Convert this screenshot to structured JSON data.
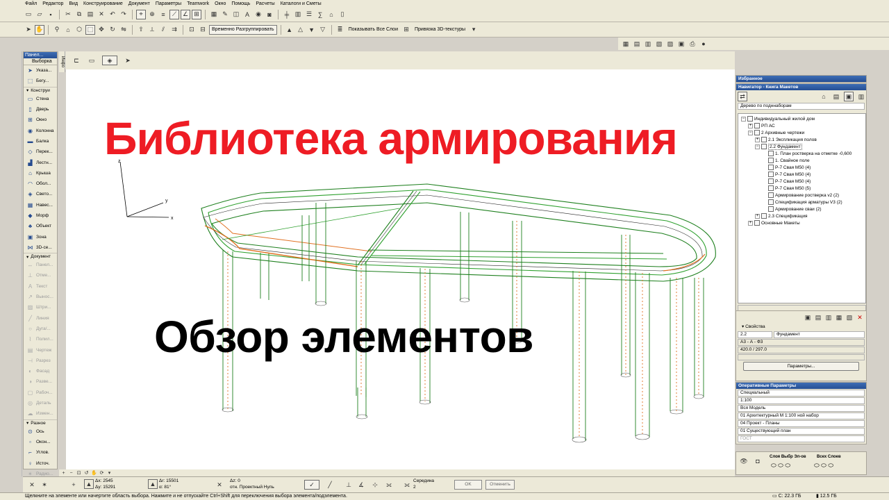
{
  "menu": [
    "Файл",
    "Редактор",
    "Вид",
    "Конструирование",
    "Документ",
    "Параметры",
    "Teamwork",
    "Окно",
    "Помощь",
    "Расчеты",
    "Каталоги и Сметы"
  ],
  "toolbar": {
    "ungroup_label": "Временно Разгруппировать",
    "show_all_layers": "Показывать Все Слои",
    "texture_binding": "Привязка 3D-текстуры"
  },
  "toolbox": {
    "header": "Панел...",
    "tab": "Выборка",
    "arrow_tool": "Указа...",
    "marquee_tool": "Бегу...",
    "group_construction": "Конструи",
    "construction_tools": [
      "Стена",
      "Дверь",
      "Окно",
      "Колонна",
      "Балка",
      "Перек...",
      "Лестн...",
      "Крыша",
      "Обол...",
      "Свето...",
      "Навес...",
      "Морф",
      "Объект",
      "Зона",
      "3D-се..."
    ],
    "group_document": "Документ",
    "document_tools": [
      "Панел...",
      "Отме...",
      "Текст",
      "Вынос...",
      "Штри...",
      "Линия",
      "Дуга/...",
      "Полил...",
      "Чертеж",
      "Разрез",
      "Фасад",
      "Разве...",
      "Рабоч...",
      "Деталь",
      "Измен..."
    ],
    "group_more": "Разное",
    "more_tools": [
      "Ось",
      "Окон...",
      "Углов.",
      "Источ.",
      "Радио..."
    ]
  },
  "infobar_tab": "Инфо",
  "overlay": {
    "title_red": "Библиотека армирования",
    "title_black": "Обзор элементов"
  },
  "axes": {
    "z": "z",
    "y": "y",
    "x": "x"
  },
  "favorites": {
    "title": "Избранное"
  },
  "navigator": {
    "title": "Навигатор - Книга Макетов",
    "view_mode": "Дерево по подннаборам",
    "tree": [
      {
        "label": "Индивидуальный жилой дом",
        "level": 0
      },
      {
        "label": "РП АС",
        "level": 1
      },
      {
        "label": "2 Архивные чертежи",
        "level": 1
      },
      {
        "label": "2.1 Экспликация полов",
        "level": 2
      },
      {
        "label": "2.2 Фундамент",
        "level": 2
      },
      {
        "label": "1. План ростверка на отметке  -0,600",
        "level": 3
      },
      {
        "label": "1. Свайное поле",
        "level": 3
      },
      {
        "label": "Р-7 Свая М50 (4)",
        "level": 3
      },
      {
        "label": "Р-7 Свая М50 (4)",
        "level": 3
      },
      {
        "label": "Р-7 Свая М50 (4)",
        "level": 3
      },
      {
        "label": "Р-7 Свая М50 (5)",
        "level": 3
      },
      {
        "label": "Армирование ростверка v2 (2)",
        "level": 3
      },
      {
        "label": "Спецификация арматуры V3 (2)",
        "level": 3
      },
      {
        "label": "Армирование сваи (2)",
        "level": 3
      },
      {
        "label": "2.3 Спецификация",
        "level": 2
      },
      {
        "label": "Основные Макеты",
        "level": 1
      }
    ]
  },
  "properties": {
    "header": "Свойства",
    "id": "2.2",
    "name": "Фундамент",
    "format": "А3 - А - Ф3",
    "size": "420.0 / 297.0",
    "params_button": "Параметры..."
  },
  "quick_options": {
    "title": "Оперативные Параметры",
    "rows": [
      "Специальный",
      "1:100",
      "Вся Модель",
      "01 Архитектурный М 1:100 ной  набор",
      "04 Проект - Планы",
      "01 Существующий план",
      "ГОСТ"
    ]
  },
  "layer_panel": {
    "col1": "Слоя Выбр Эл-ов",
    "col2": "Всех Слоев"
  },
  "coords": {
    "dx": "Δx: 2545",
    "dy": "Δy: 15291",
    "dr": "Δr: 15501",
    "angle": "α: 81°",
    "dz": "Δz: 0",
    "ref": "отн. Проектный Нуль",
    "snap_label": "Середина",
    "snap_value": "2",
    "ok": "OK",
    "cancel": "Отменить"
  },
  "status": {
    "hint": "Щелкните на элементе или начертите область выбора. Нажмите и не отпускайте Ctrl+Shift для переключения выбора элемента/подэлемента.",
    "disk_c": "C: 22.3 ГБ",
    "disk_free": "12.5 ГБ"
  },
  "colors": {
    "accent": "#254e94",
    "title_red": "#ee1c24",
    "rebar_green": "#2b9a2b",
    "rebar_orange": "#e07020"
  }
}
